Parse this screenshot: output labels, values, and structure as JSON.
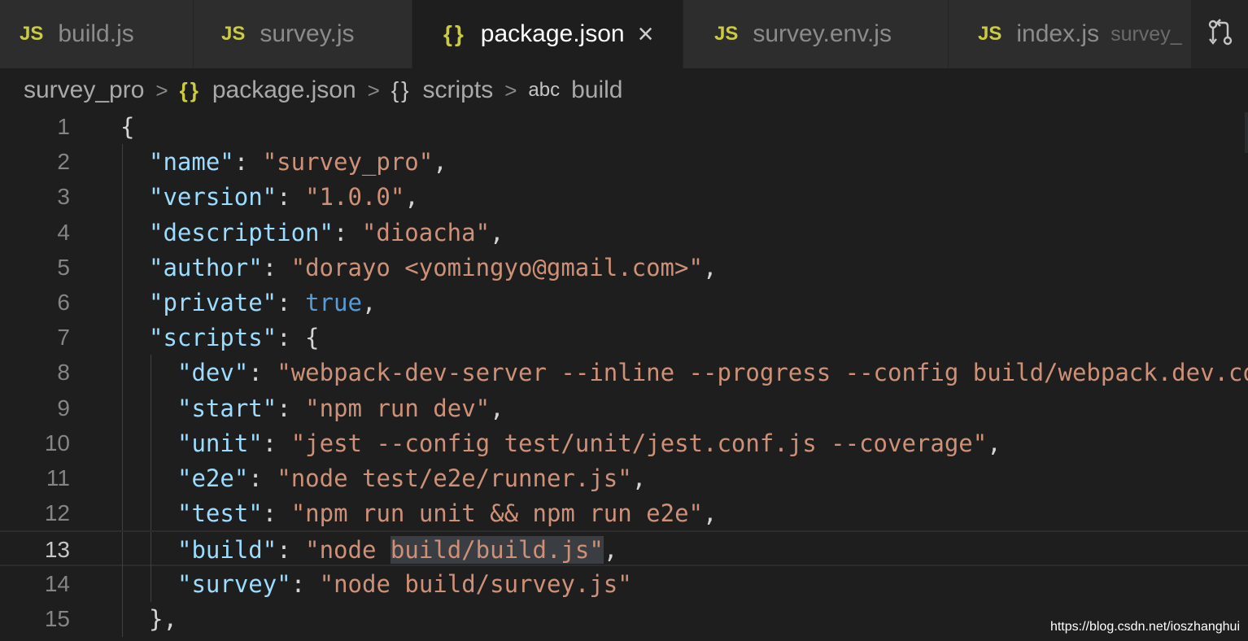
{
  "tabs": [
    {
      "label": "build.js",
      "icon": "JS",
      "active": false
    },
    {
      "label": "survey.js",
      "icon": "JS",
      "active": false
    },
    {
      "label": "package.json",
      "icon": "{}",
      "active": true,
      "close": "×"
    },
    {
      "label": "survey.env.js",
      "icon": "JS",
      "active": false
    },
    {
      "label": "index.js",
      "icon": "JS",
      "active": false,
      "description": "survey_"
    }
  ],
  "breadcrumb": {
    "root": "survey_pro",
    "file": "package.json",
    "object": "scripts",
    "property": "build",
    "separator": ">",
    "icon_json": "{}",
    "icon_object": "{}",
    "icon_abc": "abc"
  },
  "editor": {
    "current_line": 13,
    "lines": [
      {
        "n": "1",
        "indent": 0,
        "tokens": [
          {
            "t": "p",
            "v": "{"
          }
        ]
      },
      {
        "n": "2",
        "indent": 1,
        "tokens": [
          {
            "t": "k",
            "v": "\"name\""
          },
          {
            "t": "p",
            "v": ": "
          },
          {
            "t": "s",
            "v": "\"survey_pro\""
          },
          {
            "t": "p",
            "v": ","
          }
        ]
      },
      {
        "n": "3",
        "indent": 1,
        "tokens": [
          {
            "t": "k",
            "v": "\"version\""
          },
          {
            "t": "p",
            "v": ": "
          },
          {
            "t": "s",
            "v": "\"1.0.0\""
          },
          {
            "t": "p",
            "v": ","
          }
        ]
      },
      {
        "n": "4",
        "indent": 1,
        "tokens": [
          {
            "t": "k",
            "v": "\"description\""
          },
          {
            "t": "p",
            "v": ": "
          },
          {
            "t": "s",
            "v": "\"dioacha\""
          },
          {
            "t": "p",
            "v": ","
          }
        ]
      },
      {
        "n": "5",
        "indent": 1,
        "tokens": [
          {
            "t": "k",
            "v": "\"author\""
          },
          {
            "t": "p",
            "v": ": "
          },
          {
            "t": "s",
            "v": "\"dorayo <yomingyo@gmail.com>\""
          },
          {
            "t": "p",
            "v": ","
          }
        ]
      },
      {
        "n": "6",
        "indent": 1,
        "tokens": [
          {
            "t": "k",
            "v": "\"private\""
          },
          {
            "t": "p",
            "v": ": "
          },
          {
            "t": "b",
            "v": "true"
          },
          {
            "t": "p",
            "v": ","
          }
        ]
      },
      {
        "n": "7",
        "indent": 1,
        "tokens": [
          {
            "t": "k",
            "v": "\"scripts\""
          },
          {
            "t": "p",
            "v": ": {"
          }
        ]
      },
      {
        "n": "8",
        "indent": 2,
        "tokens": [
          {
            "t": "k",
            "v": "\"dev\""
          },
          {
            "t": "p",
            "v": ": "
          },
          {
            "t": "s",
            "v": "\"webpack-dev-server --inline --progress --config build/webpack.dev.co"
          }
        ]
      },
      {
        "n": "9",
        "indent": 2,
        "tokens": [
          {
            "t": "k",
            "v": "\"start\""
          },
          {
            "t": "p",
            "v": ": "
          },
          {
            "t": "s",
            "v": "\"npm run dev\""
          },
          {
            "t": "p",
            "v": ","
          }
        ]
      },
      {
        "n": "10",
        "indent": 2,
        "tokens": [
          {
            "t": "k",
            "v": "\"unit\""
          },
          {
            "t": "p",
            "v": ": "
          },
          {
            "t": "s",
            "v": "\"jest --config test/unit/jest.conf.js --coverage\""
          },
          {
            "t": "p",
            "v": ","
          }
        ]
      },
      {
        "n": "11",
        "indent": 2,
        "tokens": [
          {
            "t": "k",
            "v": "\"e2e\""
          },
          {
            "t": "p",
            "v": ": "
          },
          {
            "t": "s",
            "v": "\"node test/e2e/runner.js\""
          },
          {
            "t": "p",
            "v": ","
          }
        ]
      },
      {
        "n": "12",
        "indent": 2,
        "tokens": [
          {
            "t": "k",
            "v": "\"test\""
          },
          {
            "t": "p",
            "v": ": "
          },
          {
            "t": "s",
            "v": "\"npm run unit && npm run e2e\""
          },
          {
            "t": "p",
            "v": ","
          }
        ]
      },
      {
        "n": "13",
        "indent": 2,
        "tokens": [
          {
            "t": "k",
            "v": "\"build\""
          },
          {
            "t": "p",
            "v": ": "
          },
          {
            "t": "s",
            "v": "\"node "
          },
          {
            "t": "s hl",
            "v": "build/build.js\""
          },
          {
            "t": "p",
            "v": ","
          }
        ]
      },
      {
        "n": "14",
        "indent": 2,
        "tokens": [
          {
            "t": "k",
            "v": "\"survey\""
          },
          {
            "t": "p",
            "v": ": "
          },
          {
            "t": "s",
            "v": "\"node build/survey.js\""
          }
        ]
      },
      {
        "n": "15",
        "indent": 1,
        "tokens": [
          {
            "t": "p",
            "v": "},"
          }
        ]
      }
    ]
  },
  "watermark": "https://blog.csdn.net/ioszhanghui",
  "icons": {
    "tab_action": "open-changes-icon"
  },
  "colors": {
    "key": "#9cdcfe",
    "string": "#ce9178",
    "boolean": "#569cd6",
    "js_icon": "#cbcb41"
  }
}
